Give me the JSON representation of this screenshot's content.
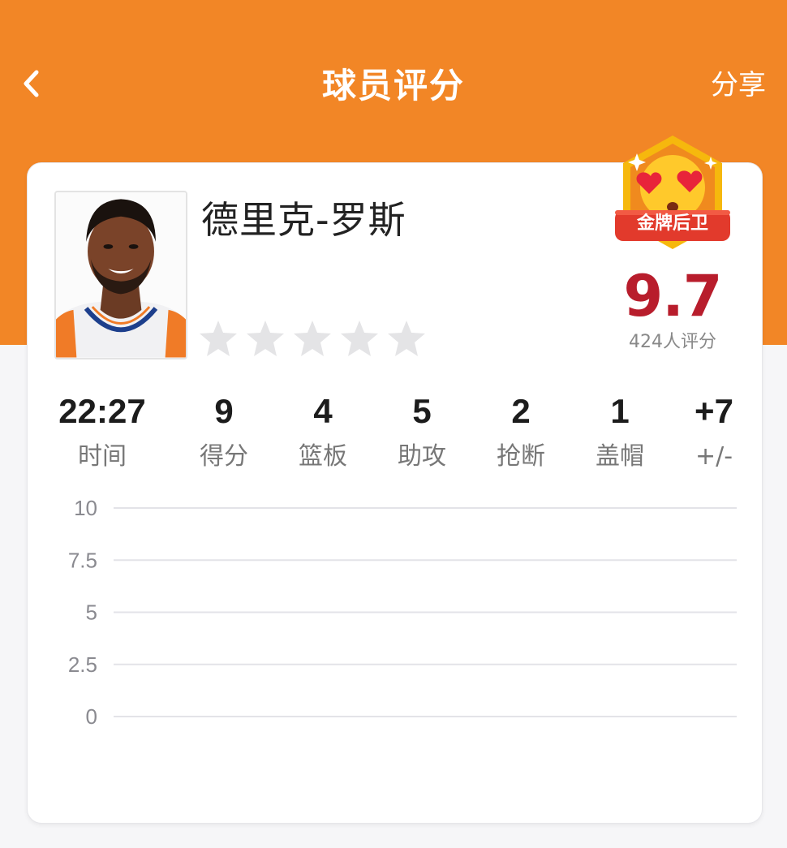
{
  "header": {
    "title": "球员评分",
    "share_label": "分享"
  },
  "player": {
    "name": "德里克-罗斯",
    "badge_label": "金牌后卫",
    "score": "9.7",
    "rating_count": "424人评分",
    "stars_filled": 0,
    "stars_total": 5
  },
  "stats": [
    {
      "value": "22:27",
      "label": "时间"
    },
    {
      "value": "9",
      "label": "得分"
    },
    {
      "value": "4",
      "label": "篮板"
    },
    {
      "value": "5",
      "label": "助攻"
    },
    {
      "value": "2",
      "label": "抢断"
    },
    {
      "value": "1",
      "label": "盖帽"
    },
    {
      "value": "+7",
      "label": "+/-"
    }
  ],
  "colors": {
    "header_bg": "#f28626",
    "score": "#b81d2c",
    "star_empty": "#e4e4e6",
    "badge_gold": "#f6b80d",
    "badge_ribbon": "#e23a2c"
  },
  "chart_data": {
    "type": "line",
    "title": "",
    "xlabel": "",
    "ylabel": "",
    "ylim": [
      0,
      10
    ],
    "y_ticks": [
      "10",
      "7.5",
      "5",
      "2.5",
      "0"
    ],
    "grid": true,
    "series": []
  }
}
